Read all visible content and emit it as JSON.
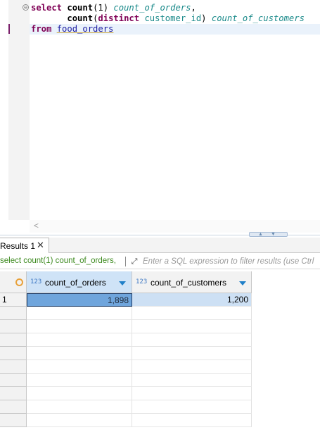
{
  "editor": {
    "fold_marker": "⊖",
    "lines": [
      [
        {
          "t": "select ",
          "c": "kw"
        },
        {
          "t": "count",
          "c": "fn"
        },
        {
          "t": "(1) ",
          "c": "plain"
        },
        {
          "t": "count_of_orders",
          "c": "alias"
        },
        {
          "t": ",",
          "c": "plain"
        }
      ],
      [
        {
          "t": "       ",
          "c": "plain"
        },
        {
          "t": "count",
          "c": "fn"
        },
        {
          "t": "(",
          "c": "plain"
        },
        {
          "t": "distinct",
          "c": "kw"
        },
        {
          "t": " ",
          "c": "plain"
        },
        {
          "t": "customer_id",
          "c": "col"
        },
        {
          "t": ") ",
          "c": "plain"
        },
        {
          "t": "count_of_customers",
          "c": "alias"
        }
      ],
      [
        {
          "t": "from ",
          "c": "kw"
        },
        {
          "t": "food_orders",
          "c": "tbl"
        }
      ]
    ],
    "scroll_left_glyph": "<"
  },
  "results_tab": {
    "label": "Results 1",
    "close_glyph": "✕"
  },
  "filter_bar": {
    "query_echo": "select count(1) count_of_orders,",
    "expand_glyph": "⤢",
    "placeholder": "Enter a SQL expression to filter results (use Ctrl"
  },
  "grid": {
    "columns": [
      {
        "type_badge": "123",
        "label": "count_of_orders"
      },
      {
        "type_badge": "123",
        "label": "count_of_customers"
      }
    ],
    "rows": [
      {
        "num": "1",
        "values": [
          "1,898",
          "1,200"
        ]
      }
    ],
    "empty_row_count": 9
  },
  "colors": {
    "keyword": "#7f0055",
    "alias": "#1a8a8a",
    "table": "#1a1aa0",
    "query_echo": "#3d8a1f",
    "selected_cell": "#6fa5dc",
    "header_selected": "#cfe3f7"
  },
  "icons": {
    "fold": "collapse-fold-icon",
    "close": "close-icon",
    "expand": "expand-filter-icon",
    "sort": "sort-dropdown-icon",
    "row_marker": "row-status-circle-icon"
  }
}
